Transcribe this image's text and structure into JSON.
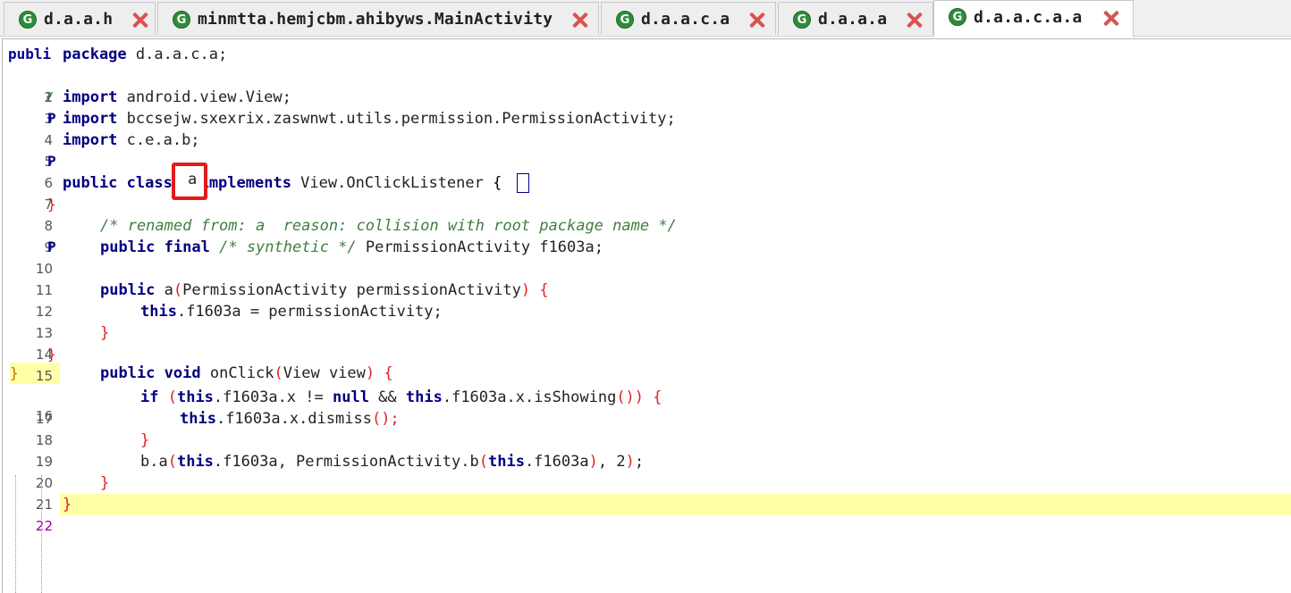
{
  "tabs": [
    {
      "label": "d.a.a.h",
      "active": false
    },
    {
      "label": "minmtta.hemjcbm.ahibyws.MainActivity",
      "active": false
    },
    {
      "label": "d.a.a.c.a",
      "active": false
    },
    {
      "label": "d.a.a.a",
      "active": false
    },
    {
      "label": "d.a.a.c.a.a",
      "active": true
    }
  ],
  "tab_icon_letter": "G",
  "gutter_markers": {
    "publi": "publi",
    "check": "✓",
    "p": "P",
    "brace": "}"
  },
  "lines": [
    {
      "n": "1"
    },
    {
      "n": "2"
    },
    {
      "n": "3"
    },
    {
      "n": "4"
    },
    {
      "n": "5"
    },
    {
      "n": "6"
    },
    {
      "n": "7"
    },
    {
      "n": "8"
    },
    {
      "n": "9"
    },
    {
      "n": "10"
    },
    {
      "n": "11"
    },
    {
      "n": "12"
    },
    {
      "n": "13"
    },
    {
      "n": "14"
    },
    {
      "n": "15"
    },
    {
      "n": "16"
    },
    {
      "n": "17"
    },
    {
      "n": "18"
    },
    {
      "n": "19"
    },
    {
      "n": "20"
    },
    {
      "n": "21"
    },
    {
      "n": "22"
    }
  ],
  "code": {
    "l1": {
      "kw": "package",
      "rest": " d.a.a.c.a;"
    },
    "l3": {
      "kw": "import",
      "rest": " android.view.View;"
    },
    "l4": {
      "kw": "import",
      "rest": " bccsejw.sxexrix.zaswnwt.utils.permission.PermissionActivity;"
    },
    "l5": {
      "kw": "import",
      "rest": " c.e.a.b;"
    },
    "l7": {
      "kw1": "public",
      "kw2": "class",
      "name": "a",
      "kw3": "implements",
      "rest": " View.OnClickListener ",
      "brace": "{"
    },
    "l9": {
      "comment": "/* renamed from: a  reason: collision with root package name */"
    },
    "l10": {
      "kw1": "public",
      "kw2": "final",
      "comment": "/* synthetic */",
      "rest": " PermissionActivity f1603a;"
    },
    "l12": {
      "kw1": "public",
      "rest1": " a",
      "p1": "(",
      "rest2": "PermissionActivity permissionActivity",
      "p2": ")",
      "brace": " {"
    },
    "l13": {
      "kw": "this",
      "rest": ".f1603a = permissionActivity;"
    },
    "l14": {
      "brace": "}"
    },
    "l16": {
      "kw1": "public",
      "kw2": "void",
      "rest1": " onClick",
      "p1": "(",
      "rest2": "View view",
      "p2": ")",
      "brace": " {"
    },
    "l17": {
      "kw1": "if",
      "p1": " (",
      "kw2": "this",
      "rest1": ".f1603a.x != ",
      "kw3": "null",
      "rest2": " && ",
      "kw4": "this",
      "rest3": ".f1603a.x.isShowing",
      "p2": "()) {"
    },
    "l18": {
      "kw": "this",
      "rest": ".f1603a.x.dismiss",
      "p": "();"
    },
    "l19": {
      "brace": "}"
    },
    "l20": {
      "rest1": "b.a",
      "p1": "(",
      "kw1": "this",
      "rest2": ".f1603a, PermissionActivity.b",
      "p2": "(",
      "kw2": "this",
      "rest3": ".f1603a",
      "p3": ")",
      "rest4": ", 2",
      "p4": ")",
      "rest5": ";"
    },
    "l21": {
      "brace": "}"
    },
    "l22": {
      "brace": "}"
    }
  }
}
